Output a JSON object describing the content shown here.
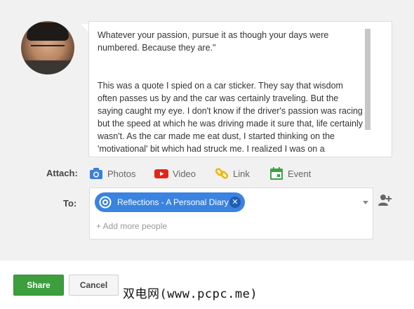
{
  "message": {
    "paragraph1": "Whatever your passion, pursue it as though your days were numbered. Because they are.\"",
    "paragraph2": "This was a quote I spied on a car sticker. They say that wisdom often passes us by and the car was certainly traveling. But the saying caught my eye. I don't know if the driver's passion was racing but the speed at which he was driving made it sure that, life certainly wasn't. As the car made me eat dust, I started thinking on the 'motivational' bit which had struck me. I realized I was on a"
  },
  "attach": {
    "label": "Attach:",
    "items": [
      {
        "label": "Photos",
        "icon": "camera-icon",
        "color": "#3b7fdc"
      },
      {
        "label": "Video",
        "icon": "youtube-icon",
        "color": "#e1251b"
      },
      {
        "label": "Link",
        "icon": "link-icon",
        "color": "#f2b400"
      },
      {
        "label": "Event",
        "icon": "calendar-icon",
        "color": "#3da345"
      }
    ]
  },
  "recipients": {
    "label": "To:",
    "chip_label": "Reflections - A Personal Diary",
    "chip_color": "#3a83e0",
    "add_more": "+ Add more people"
  },
  "buttons": {
    "share": "Share",
    "cancel": "Cancel"
  },
  "watermark": "双电网(www.pcpc.me)"
}
